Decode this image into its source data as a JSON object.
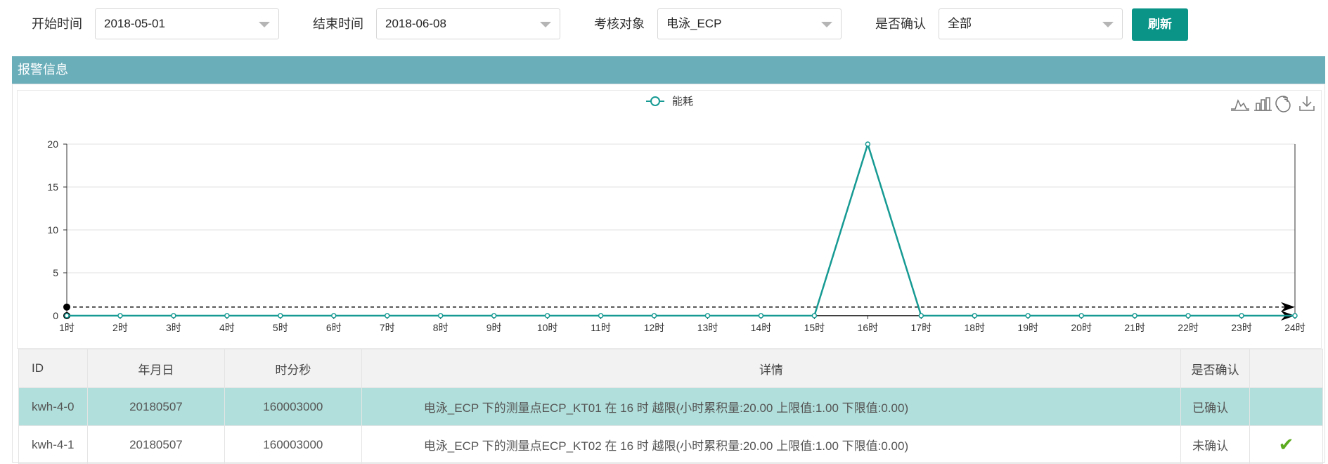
{
  "filters": {
    "start_label": "开始时间",
    "start_value": "2018-05-01",
    "end_label": "结束时间",
    "end_value": "2018-06-08",
    "target_label": "考核对象",
    "target_value": "电泳_ECP",
    "confirmed_label": "是否确认",
    "confirmed_value": "全部",
    "refresh_label": "刷新"
  },
  "panel": {
    "title": "报警信息"
  },
  "toolbox": {
    "icons": [
      "line-chart-icon",
      "bar-chart-icon",
      "restore-icon",
      "download-icon"
    ]
  },
  "colors": {
    "series": "#169a93",
    "accent": "#099487",
    "header": "#6aaeba",
    "selected_row": "#b1dfdb",
    "check": "#5cab1f"
  },
  "chart_data": {
    "type": "line",
    "legend": "能耗",
    "categories": [
      "1时",
      "2时",
      "3时",
      "4时",
      "5时",
      "6时",
      "7时",
      "8时",
      "9时",
      "10时",
      "11时",
      "12时",
      "13时",
      "14时",
      "15时",
      "16时",
      "17时",
      "18时",
      "19时",
      "20时",
      "21时",
      "22时",
      "23时",
      "24时"
    ],
    "series": [
      {
        "name": "能耗",
        "values": [
          0,
          0,
          0,
          0,
          0,
          0,
          0,
          0,
          0,
          0,
          0,
          0,
          0,
          0,
          0,
          20,
          0,
          0,
          0,
          0,
          0,
          0,
          0,
          0
        ]
      }
    ],
    "thresholds": {
      "upper": 1,
      "lower": 0
    },
    "y_ticks": [
      0,
      5,
      10,
      15,
      20
    ],
    "ylim": [
      0,
      20
    ],
    "grid": true,
    "legend_position": "top-center"
  },
  "table": {
    "headers": {
      "id": "ID",
      "date": "年月日",
      "time": "时分秒",
      "detail": "详情",
      "confirmed": "是否确认"
    },
    "rows": [
      {
        "id": "kwh-4-0",
        "date": "20180507",
        "time": "160003000",
        "detail": "电泳_ECP 下的测量点ECP_KT01 在 16 时 越限(小时累积量:20.00 上限值:1.00 下限值:0.00)",
        "confirmed": "已确认",
        "action": ""
      },
      {
        "id": "kwh-4-1",
        "date": "20180507",
        "time": "160003000",
        "detail": "电泳_ECP 下的测量点ECP_KT02 在 16 时 越限(小时累积量:20.00 上限值:1.00 下限值:0.00)",
        "confirmed": "未确认",
        "action": "✔"
      }
    ]
  }
}
